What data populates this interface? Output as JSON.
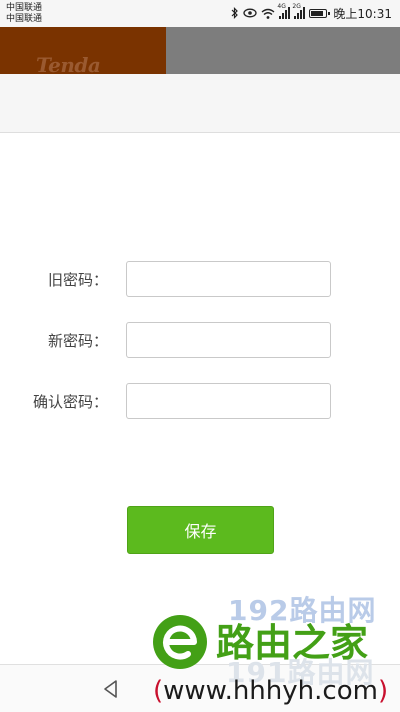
{
  "status_bar": {
    "carrier_1": "中国联通",
    "carrier_2": "中国联通",
    "network_1": "4G",
    "network_2": "2G",
    "time": "晚上10:31"
  },
  "header": {
    "logo": "Tenda",
    "colors": {
      "brand_block": "#7a3300",
      "bar": "#7d7d7d"
    }
  },
  "form": {
    "old_password_label": "旧密码：",
    "old_password_value": "",
    "new_password_label": "新密码：",
    "new_password_value": "",
    "confirm_password_label": "确认密码：",
    "confirm_password_value": ""
  },
  "actions": {
    "save_label": "保存",
    "save_color": "#5cba1e"
  },
  "watermark": {
    "top_text": "192路由网",
    "site_name": "路由之家",
    "bottom_text": "191路由网",
    "url_open": "(",
    "url": "www.hhhyh.com",
    "url_close": ")"
  }
}
